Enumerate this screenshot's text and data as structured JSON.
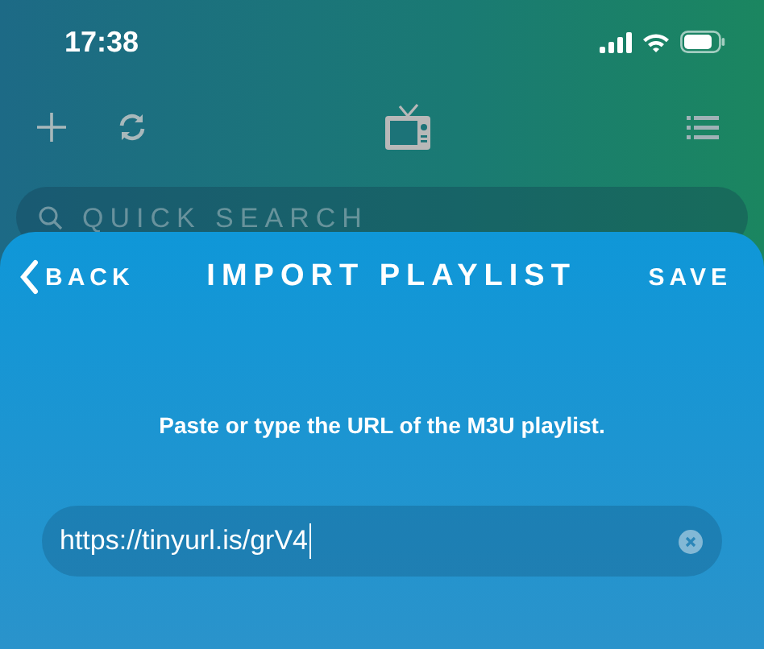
{
  "status_bar": {
    "time": "17:38"
  },
  "toolbar": {
    "search": {
      "placeholder": "QUICK SEARCH"
    }
  },
  "sheet": {
    "back": "BACK",
    "title": "IMPORT PLAYLIST",
    "save": "SAVE",
    "instruction": "Paste or type the URL of the M3U playlist.",
    "url_field": {
      "value": "https://tinyurl.is/grV4"
    }
  }
}
